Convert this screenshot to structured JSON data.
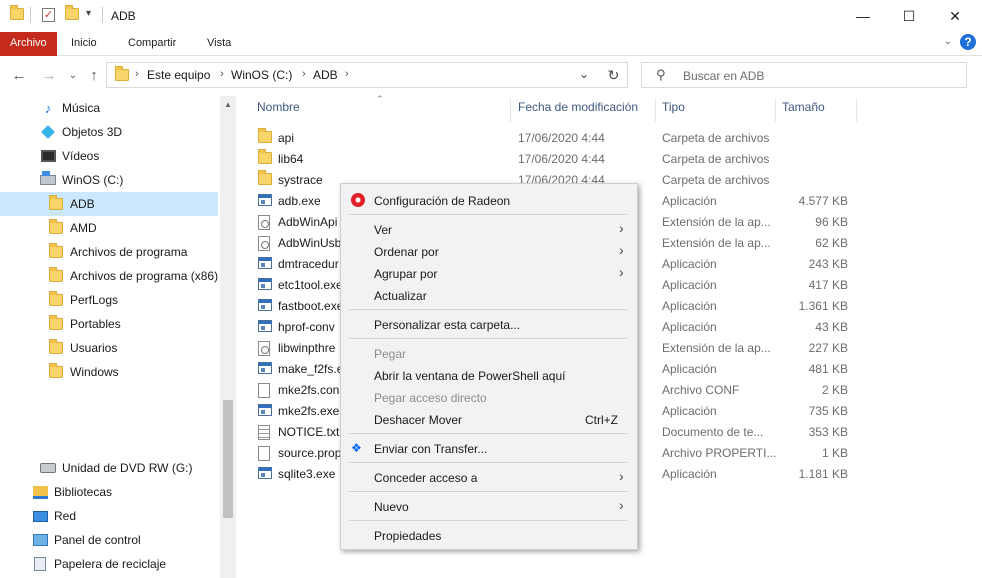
{
  "window": {
    "title": "ADB",
    "controls": {
      "minimize": "—",
      "maximize": "☐",
      "close": "✕"
    }
  },
  "ribbon": {
    "tabs": [
      "Archivo",
      "Inicio",
      "Compartir",
      "Vista"
    ],
    "help": "?"
  },
  "address": {
    "crumbs": [
      "Este equipo",
      "WinOS (C:)",
      "ADB"
    ]
  },
  "search": {
    "placeholder": "Buscar en ADB"
  },
  "nav": {
    "items": [
      {
        "label": "Música",
        "icon": "music-icon"
      },
      {
        "label": "Objetos 3D",
        "icon": "cube-icon"
      },
      {
        "label": "Vídeos",
        "icon": "video-icon"
      },
      {
        "label": "WinOS (C:)",
        "icon": "drive-icon"
      },
      {
        "label": "ADB",
        "icon": "folder-icon",
        "selected": true
      },
      {
        "label": "AMD",
        "icon": "folder-icon"
      },
      {
        "label": "Archivos de programa",
        "icon": "folder-icon"
      },
      {
        "label": "Archivos de programa (x86)",
        "icon": "folder-icon"
      },
      {
        "label": "PerfLogs",
        "icon": "folder-icon"
      },
      {
        "label": "Portables",
        "icon": "folder-icon"
      },
      {
        "label": "Usuarios",
        "icon": "folder-icon"
      },
      {
        "label": "Windows",
        "icon": "folder-icon"
      }
    ],
    "bottom": [
      {
        "label": "Unidad de DVD RW (G:)",
        "icon": "dvd-icon"
      },
      {
        "label": "Bibliotecas",
        "icon": "library-icon"
      },
      {
        "label": "Red",
        "icon": "network-icon"
      },
      {
        "label": "Panel de control",
        "icon": "control-panel-icon"
      },
      {
        "label": "Papelera de reciclaje",
        "icon": "recycle-bin-icon"
      }
    ]
  },
  "columns": {
    "name": "Nombre",
    "date": "Fecha de modificación",
    "type": "Tipo",
    "size": "Tamaño"
  },
  "files": [
    {
      "name": "api",
      "date": "17/06/2020 4:44",
      "type": "Carpeta de archivos",
      "size": "",
      "icon": "folder"
    },
    {
      "name": "lib64",
      "date": "17/06/2020 4:44",
      "type": "Carpeta de archivos",
      "size": "",
      "icon": "folder"
    },
    {
      "name": "systrace",
      "date": "17/06/2020 4:44",
      "type": "Carpeta de archivos",
      "size": "",
      "icon": "folder"
    },
    {
      "name": "adb.exe",
      "date": "",
      "type": "Aplicación",
      "size": "4.577 KB",
      "icon": "exe"
    },
    {
      "name": "AdbWinApi",
      "date": "",
      "type": "Extensión de la ap...",
      "size": "96 KB",
      "icon": "dll"
    },
    {
      "name": "AdbWinUsb",
      "date": "",
      "type": "Extensión de la ap...",
      "size": "62 KB",
      "icon": "dll"
    },
    {
      "name": "dmtracedur",
      "date": "",
      "type": "Aplicación",
      "size": "243 KB",
      "icon": "exe"
    },
    {
      "name": "etc1tool.exe",
      "date": "",
      "type": "Aplicación",
      "size": "417 KB",
      "icon": "exe"
    },
    {
      "name": "fastboot.exe",
      "date": "",
      "type": "Aplicación",
      "size": "1.361 KB",
      "icon": "exe"
    },
    {
      "name": "hprof-conv",
      "date": "",
      "type": "Aplicación",
      "size": "43 KB",
      "icon": "exe"
    },
    {
      "name": "libwinpthre",
      "date": "",
      "type": "Extensión de la ap...",
      "size": "227 KB",
      "icon": "dll"
    },
    {
      "name": "make_f2fs.e",
      "date": "",
      "type": "Aplicación",
      "size": "481 KB",
      "icon": "exe"
    },
    {
      "name": "mke2fs.con",
      "date": "",
      "type": "Archivo CONF",
      "size": "2 KB",
      "icon": "doc"
    },
    {
      "name": "mke2fs.exe",
      "date": "",
      "type": "Aplicación",
      "size": "735 KB",
      "icon": "exe"
    },
    {
      "name": "NOTICE.txt",
      "date": "",
      "type": "Documento de te...",
      "size": "353 KB",
      "icon": "txt"
    },
    {
      "name": "source.prop",
      "date": "",
      "type": "Archivo PROPERTI...",
      "size": "1 KB",
      "icon": "doc"
    },
    {
      "name": "sqlite3.exe",
      "date": "",
      "type": "Aplicación",
      "size": "1.181 KB",
      "icon": "exe"
    }
  ],
  "context_menu": {
    "items": [
      {
        "label": "Configuración de Radeon",
        "icon": "radeon-icon"
      },
      {
        "sep": true
      },
      {
        "label": "Ver",
        "submenu": true
      },
      {
        "label": "Ordenar por",
        "submenu": true
      },
      {
        "label": "Agrupar por",
        "submenu": true
      },
      {
        "label": "Actualizar"
      },
      {
        "sep": true
      },
      {
        "label": "Personalizar esta carpeta..."
      },
      {
        "sep": true
      },
      {
        "label": "Pegar",
        "disabled": true
      },
      {
        "label": "Abrir la ventana de PowerShell aquí"
      },
      {
        "label": "Pegar acceso directo",
        "disabled": true
      },
      {
        "label": "Deshacer Mover",
        "shortcut": "Ctrl+Z"
      },
      {
        "sep": true
      },
      {
        "label": "Enviar con Transfer...",
        "icon": "dropbox-icon"
      },
      {
        "sep": true
      },
      {
        "label": "Conceder acceso a",
        "submenu": true
      },
      {
        "sep": true
      },
      {
        "label": "Nuevo",
        "submenu": true
      },
      {
        "sep": true
      },
      {
        "label": "Propiedades"
      }
    ]
  },
  "colors": {
    "file_tab": "#c42b1c",
    "selection": "#cce8ff",
    "header_text": "#3d5a80"
  }
}
